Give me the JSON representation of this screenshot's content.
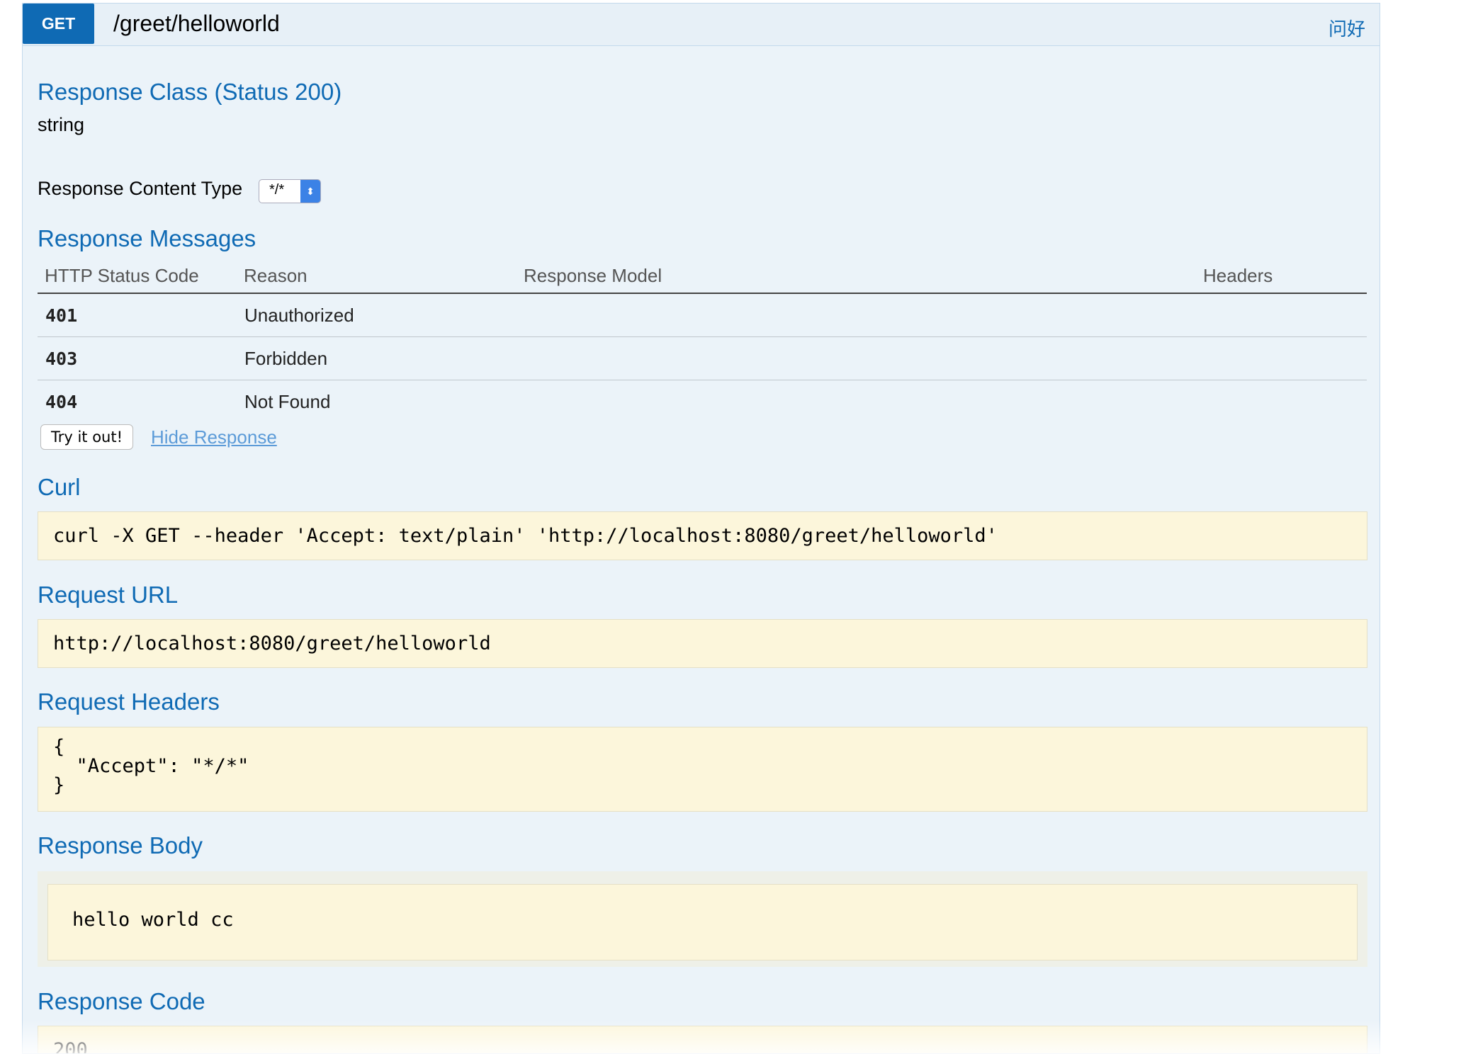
{
  "operation": {
    "method": "GET",
    "path": "/greet/helloworld",
    "summary": "问好"
  },
  "response_class": {
    "heading": "Response Class (Status 200)",
    "type": "string"
  },
  "content_type": {
    "label": "Response Content Type",
    "selected": "*/*"
  },
  "response_messages": {
    "heading": "Response Messages",
    "columns": [
      "HTTP Status Code",
      "Reason",
      "Response Model",
      "Headers"
    ],
    "rows": [
      {
        "code": "401",
        "reason": "Unauthorized",
        "model": "",
        "headers": ""
      },
      {
        "code": "403",
        "reason": "Forbidden",
        "model": "",
        "headers": ""
      },
      {
        "code": "404",
        "reason": "Not Found",
        "model": "",
        "headers": ""
      }
    ]
  },
  "actions": {
    "try_label": "Try it out!",
    "hide_label": "Hide Response"
  },
  "curl": {
    "heading": "Curl",
    "command": "curl -X GET --header 'Accept: text/plain' 'http://localhost:8080/greet/helloworld'"
  },
  "request_url": {
    "heading": "Request URL",
    "value": "http://localhost:8080/greet/helloworld"
  },
  "request_headers": {
    "heading": "Request Headers",
    "value": "{\n  \"Accept\": \"*/*\"\n}"
  },
  "response_body": {
    "heading": "Response Body",
    "value": "hello world cc"
  },
  "response_code": {
    "heading": "Response Code",
    "value": "200"
  },
  "colors": {
    "accent": "#0f6ab4",
    "panel_bg": "#ebf3f9",
    "code_bg": "#fcf6db"
  }
}
